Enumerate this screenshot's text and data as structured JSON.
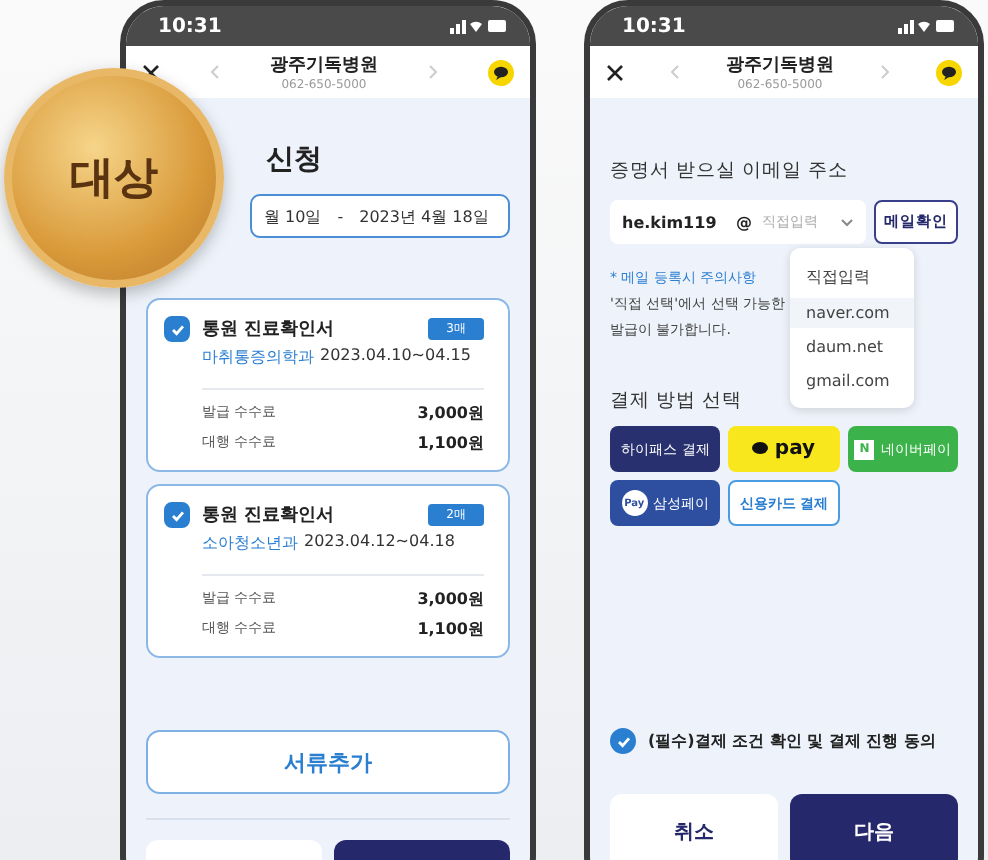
{
  "badge": {
    "label": "대상"
  },
  "left_phone": {
    "status_time": "10:31",
    "header": {
      "title": "광주기독병원",
      "phone": "062-650-5000"
    },
    "page_title": "신청",
    "date_range": {
      "from": "월 10일",
      "separator": "-",
      "to": "2023년 4월 18일"
    },
    "documents": [
      {
        "title": "통원 진료확인서",
        "checked": true,
        "count": "3매",
        "department": "마취통증의학과",
        "period": "2023.04.10~04.15",
        "fees": [
          {
            "label": "발급 수수료",
            "amount": "3,000원"
          },
          {
            "label": "대행 수수료",
            "amount": "1,100원"
          }
        ]
      },
      {
        "title": "통원 진료확인서",
        "checked": true,
        "count": "2매",
        "department": "소아청소년과",
        "period": "2023.04.12~04.18",
        "fees": [
          {
            "label": "발급 수수료",
            "amount": "3,000원"
          },
          {
            "label": "대행 수수료",
            "amount": "1,100원"
          }
        ]
      }
    ],
    "add_button": "서류추가"
  },
  "right_phone": {
    "status_time": "10:31",
    "header": {
      "title": "광주기독병원",
      "phone": "062-650-5000"
    },
    "email_label": "증명서 받으실 이메일 주소",
    "email": {
      "value": "he.kim119",
      "at": "@",
      "domain_placeholder": "직접입력",
      "confirm_button": "메일확인"
    },
    "domain_options": [
      {
        "label": "직접입력",
        "selected": false
      },
      {
        "label": "naver.com",
        "selected": true
      },
      {
        "label": "daum.net",
        "selected": false
      },
      {
        "label": "gmail.com",
        "selected": false
      }
    ],
    "notice_title": "* 메일 등록시 주의사항",
    "notice_lines": [
      "'직접 선택'에서 선택 가능한",
      "발급이 불가합니다."
    ],
    "payment_label": "결제 방법 선택",
    "payment_methods": [
      {
        "kind": "hipass",
        "label": "하이패스 결제"
      },
      {
        "kind": "kakao",
        "label": "pay"
      },
      {
        "kind": "naver",
        "label": "네이버페이",
        "icon_text": "N"
      },
      {
        "kind": "samsung",
        "label": "삼성페이",
        "icon_text": "Pay"
      },
      {
        "kind": "card",
        "label": "신용카드 결제"
      }
    ],
    "agreement": {
      "label": "(필수)결제 조건 확인 및 결제 진행 동의",
      "checked": true
    },
    "buttons": [
      {
        "kind": "secondary",
        "label": "취소"
      },
      {
        "kind": "primary",
        "label": "다음"
      }
    ]
  }
}
